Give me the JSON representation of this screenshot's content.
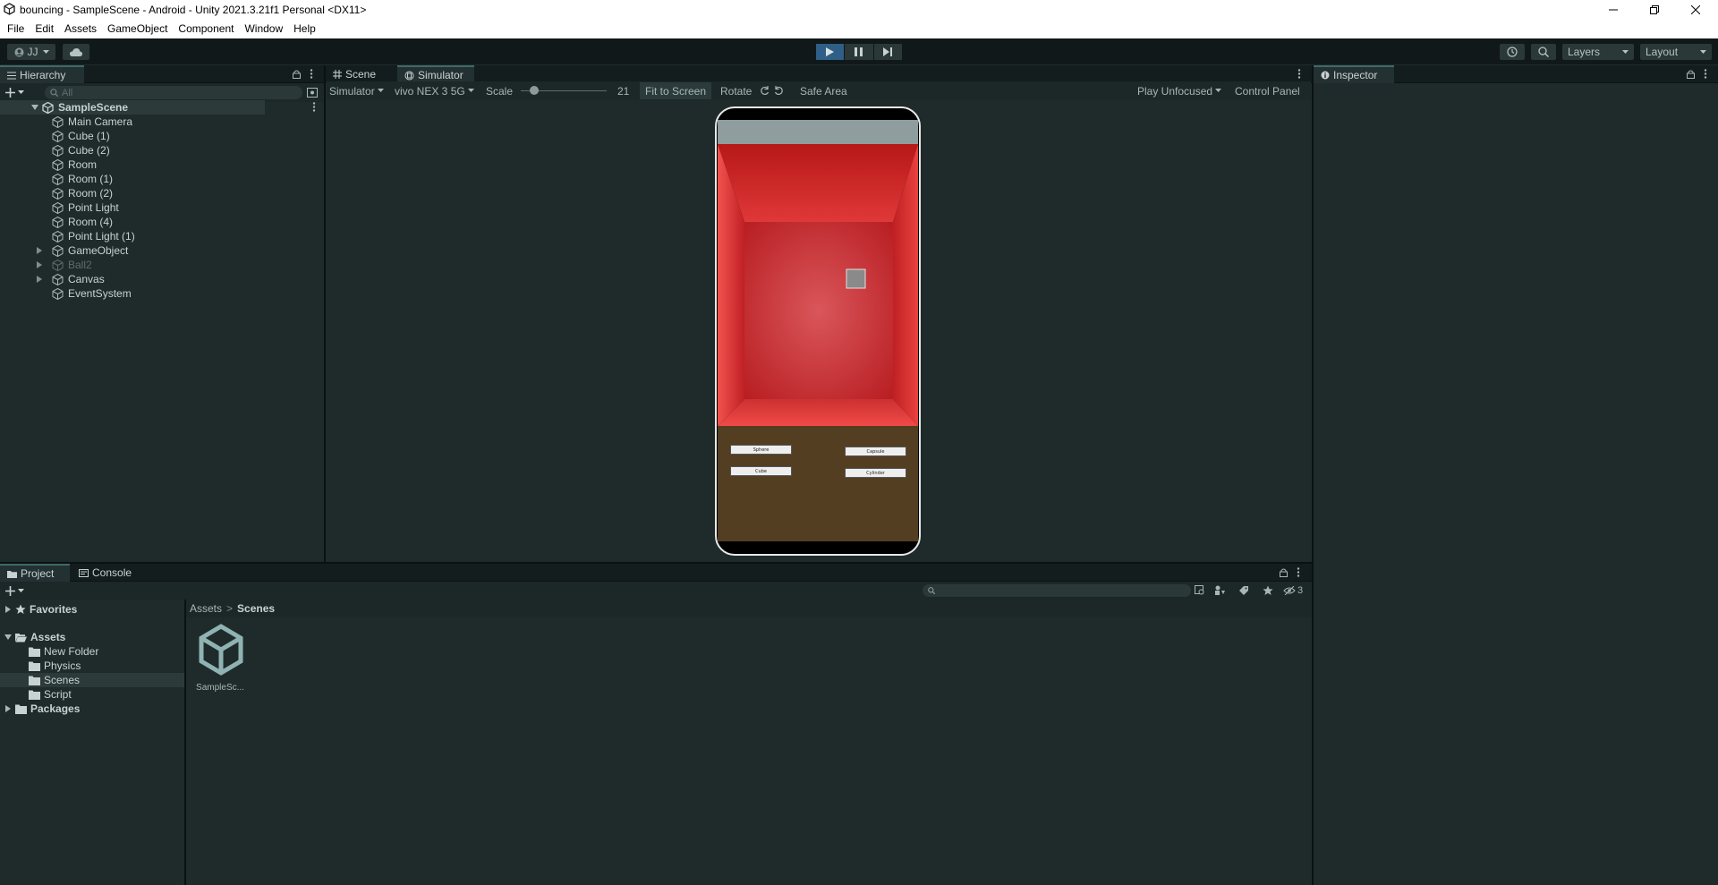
{
  "window": {
    "title": "bouncing - SampleScene - Android - Unity 2021.3.21f1 Personal <DX11>"
  },
  "menu": [
    "File",
    "Edit",
    "Assets",
    "GameObject",
    "Component",
    "Window",
    "Help"
  ],
  "toolbar": {
    "account": "JJ",
    "layers": "Layers",
    "layout": "Layout"
  },
  "hierarchy": {
    "tab": "Hierarchy",
    "search_placeholder": "All",
    "scene": "SampleScene",
    "items": [
      {
        "label": "Main Camera",
        "expandable": false,
        "dim": false
      },
      {
        "label": "Cube (1)",
        "expandable": false,
        "dim": false
      },
      {
        "label": "Cube (2)",
        "expandable": false,
        "dim": false
      },
      {
        "label": "Room",
        "expandable": false,
        "dim": false
      },
      {
        "label": "Room (1)",
        "expandable": false,
        "dim": false
      },
      {
        "label": "Room (2)",
        "expandable": false,
        "dim": false
      },
      {
        "label": "Point Light",
        "expandable": false,
        "dim": false
      },
      {
        "label": "Room (4)",
        "expandable": false,
        "dim": false
      },
      {
        "label": "Point Light (1)",
        "expandable": false,
        "dim": false
      },
      {
        "label": "GameObject",
        "expandable": true,
        "dim": false
      },
      {
        "label": "Ball2",
        "expandable": true,
        "dim": true
      },
      {
        "label": "Canvas",
        "expandable": true,
        "dim": false
      },
      {
        "label": "EventSystem",
        "expandable": false,
        "dim": false
      }
    ]
  },
  "center": {
    "tabs": [
      {
        "label": "Scene"
      },
      {
        "label": "Simulator"
      }
    ],
    "sim": {
      "view": "Simulator",
      "device": "vivo NEX 3 5G",
      "scale_label": "Scale",
      "scale_value": "21",
      "fit": "Fit to Screen",
      "rotate": "Rotate",
      "safe_area": "Safe Area",
      "play_mode": "Play Unfocused",
      "control_panel": "Control Panel"
    },
    "game_buttons": {
      "sphere": "Sphere",
      "capsule": "Capsule",
      "cube": "Cube",
      "cylinder": "Cylinder"
    }
  },
  "inspector": {
    "tab": "Inspector"
  },
  "bottom": {
    "tabs": [
      {
        "label": "Project"
      },
      {
        "label": "Console"
      }
    ],
    "hidden_count": "3",
    "favorites": "Favorites",
    "assets": "Assets",
    "asset_folders": [
      "New Folder",
      "Physics",
      "Scenes",
      "Script"
    ],
    "packages": "Packages",
    "breadcrumb": {
      "root": "Assets",
      "separator": ">",
      "current": "Scenes"
    },
    "files": [
      {
        "label": "SampleSc..."
      }
    ]
  }
}
